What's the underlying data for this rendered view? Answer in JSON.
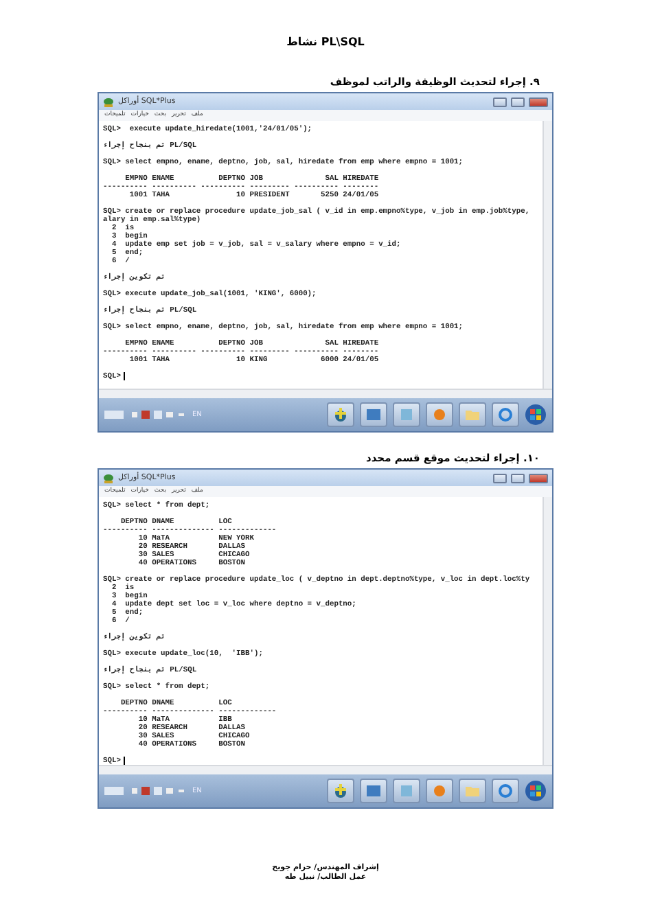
{
  "page_title": "نشاط PL\\SQL",
  "sections": [
    {
      "heading": "٩. إجراء لتحديث الوظيفة والراتب لموظف",
      "window": {
        "title": "أوراكل SQL*Plus",
        "menu": [
          "ملف",
          "تحرير",
          "بحث",
          "خيارات",
          "تلميحات"
        ],
        "lines": [
          {
            "kind": "line",
            "text": "SQL>  execute update_hiredate(1001,'24/01/05');"
          },
          {
            "kind": "gap"
          },
          {
            "kind": "line",
            "text": "تم بنجاح إجراء PL/SQL"
          },
          {
            "kind": "gap"
          },
          {
            "kind": "line",
            "text": "SQL> select empno, ename, deptno, job, sal, hiredate from emp where empno = 1001;"
          },
          {
            "kind": "gap"
          },
          {
            "kind": "line",
            "text": "     EMPNO ENAME          DEPTNO JOB              SAL HIREDATE"
          },
          {
            "kind": "line",
            "text": "---------- ---------- ---------- --------- ---------- --------"
          },
          {
            "kind": "line",
            "text": "      1001 TAHA               10 PRESIDENT       5250 24/01/05"
          },
          {
            "kind": "gap"
          },
          {
            "kind": "line",
            "text": "SQL> create or replace procedure update_job_sal ( v_id in emp.empno%type, v_job in emp.job%type,"
          },
          {
            "kind": "line",
            "text": "alary in emp.sal%type)"
          },
          {
            "kind": "line",
            "text": "  2  is"
          },
          {
            "kind": "line",
            "text": "  3  begin"
          },
          {
            "kind": "line",
            "text": "  4  update emp set job = v_job, sal = v_salary where empno = v_id;"
          },
          {
            "kind": "line",
            "text": "  5  end;"
          },
          {
            "kind": "line",
            "text": "  6  /"
          },
          {
            "kind": "gap"
          },
          {
            "kind": "line",
            "text": "تم تكوين إجراء"
          },
          {
            "kind": "gap"
          },
          {
            "kind": "line",
            "text": "SQL> execute update_job_sal(1001, 'KING', 6000);"
          },
          {
            "kind": "gap"
          },
          {
            "kind": "line",
            "text": "تم بنجاح إجراء PL/SQL"
          },
          {
            "kind": "gap"
          },
          {
            "kind": "line",
            "text": "SQL> select empno, ename, deptno, job, sal, hiredate from emp where empno = 1001;"
          },
          {
            "kind": "gap"
          },
          {
            "kind": "line",
            "text": "     EMPNO ENAME          DEPTNO JOB              SAL HIREDATE"
          },
          {
            "kind": "line",
            "text": "---------- ---------- ---------- --------- ---------- --------"
          },
          {
            "kind": "line",
            "text": "      1001 TAHA               10 KING            6000 24/01/05"
          },
          {
            "kind": "gap"
          },
          {
            "kind": "prompt",
            "text": "SQL>"
          }
        ],
        "tray_language": "EN"
      }
    },
    {
      "heading": "١٠. إجراء لتحديث موقع قسم محدد",
      "window": {
        "title": "أوراكل SQL*Plus",
        "menu": [
          "ملف",
          "تحرير",
          "بحث",
          "خيارات",
          "تلميحات"
        ],
        "lines": [
          {
            "kind": "line",
            "text": "SQL> select * from dept;"
          },
          {
            "kind": "gap"
          },
          {
            "kind": "line",
            "text": "    DEPTNO DNAME          LOC"
          },
          {
            "kind": "line",
            "text": "---------- -------------- -------------"
          },
          {
            "kind": "line",
            "text": "        10 MaTA           NEW YORK"
          },
          {
            "kind": "line",
            "text": "        20 RESEARCH       DALLAS"
          },
          {
            "kind": "line",
            "text": "        30 SALES          CHICAGO"
          },
          {
            "kind": "line",
            "text": "        40 OPERATIONS     BOSTON"
          },
          {
            "kind": "gap"
          },
          {
            "kind": "line",
            "text": "SQL> create or replace procedure update_loc ( v_deptno in dept.deptno%type, v_loc in dept.loc%ty"
          },
          {
            "kind": "line",
            "text": "  2  is"
          },
          {
            "kind": "line",
            "text": "  3  begin"
          },
          {
            "kind": "line",
            "text": "  4  update dept set loc = v_loc where deptno = v_deptno;"
          },
          {
            "kind": "line",
            "text": "  5  end;"
          },
          {
            "kind": "line",
            "text": "  6  /"
          },
          {
            "kind": "gap"
          },
          {
            "kind": "line",
            "text": "تم تكوين إجراء"
          },
          {
            "kind": "gap"
          },
          {
            "kind": "line",
            "text": "SQL> execute update_loc(10,  'IBB');"
          },
          {
            "kind": "gap"
          },
          {
            "kind": "line",
            "text": "تم بنجاح إجراء PL/SQL"
          },
          {
            "kind": "gap"
          },
          {
            "kind": "line",
            "text": "SQL> select * from dept;"
          },
          {
            "kind": "gap"
          },
          {
            "kind": "line",
            "text": "    DEPTNO DNAME          LOC"
          },
          {
            "kind": "line",
            "text": "---------- -------------- -------------"
          },
          {
            "kind": "line",
            "text": "        10 MaTA           IBB"
          },
          {
            "kind": "line",
            "text": "        20 RESEARCH       DALLAS"
          },
          {
            "kind": "line",
            "text": "        30 SALES          CHICAGO"
          },
          {
            "kind": "line",
            "text": "        40 OPERATIONS     BOSTON"
          },
          {
            "kind": "gap"
          },
          {
            "kind": "prompt",
            "text": "SQL>"
          }
        ],
        "tray_language": "EN"
      }
    }
  ],
  "footer": [
    "إشراف المهندس/ حزام جويح",
    "عمل الطالب/ نبيل طه"
  ]
}
